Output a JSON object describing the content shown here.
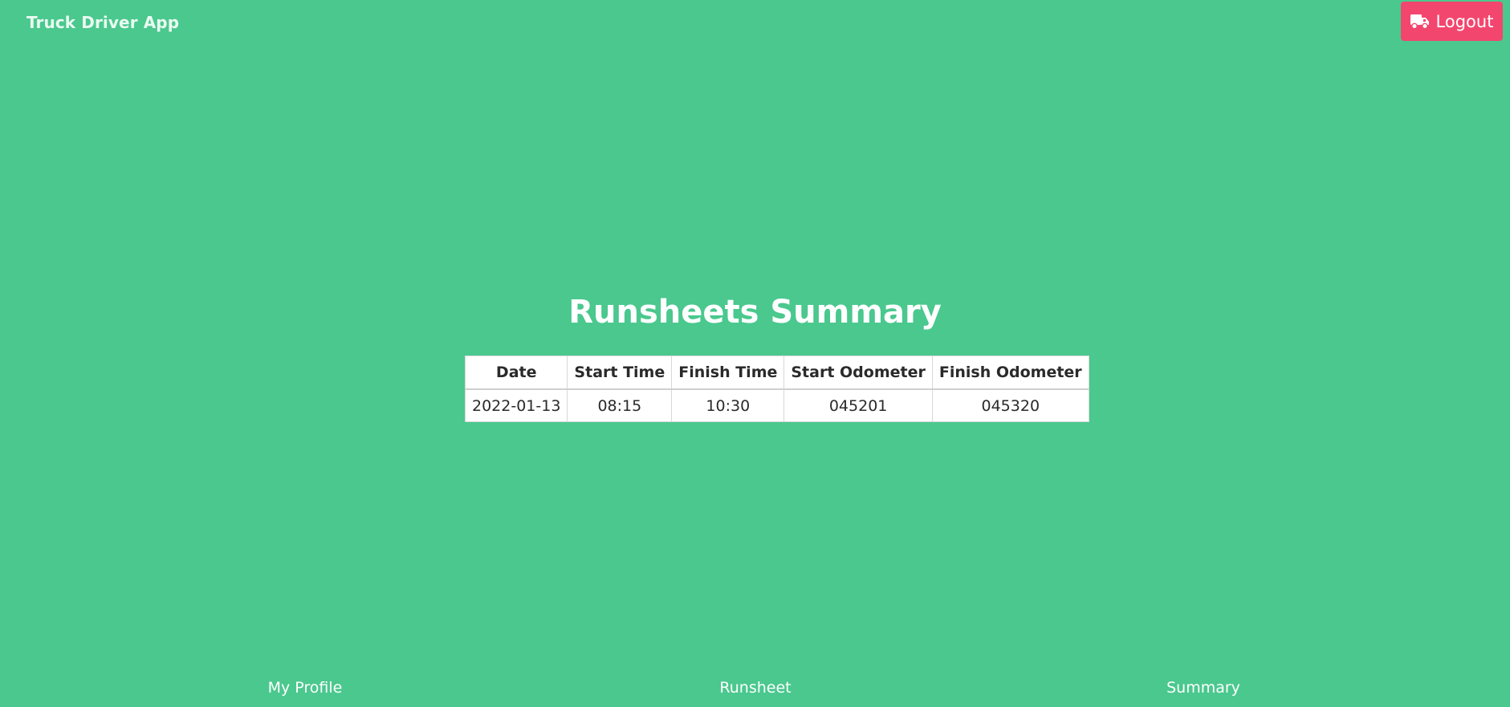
{
  "app": {
    "brand": "Truck Driver App",
    "logout_label": "Logout",
    "logout_icon": "truck-icon"
  },
  "main": {
    "title": "Runsheets Summary",
    "table": {
      "headers": [
        "Date",
        "Start Time",
        "Finish Time",
        "Start Odometer",
        "Finish Odometer"
      ],
      "rows": [
        [
          "2022-01-13",
          "08:15",
          "10:30",
          "045201",
          "045320"
        ]
      ]
    }
  },
  "bottom_nav": {
    "items": [
      "My Profile",
      "Runsheet",
      "Summary"
    ]
  },
  "colors": {
    "background": "#4ac88e",
    "logout_button": "#f3466e",
    "table_background": "#ffffff"
  }
}
